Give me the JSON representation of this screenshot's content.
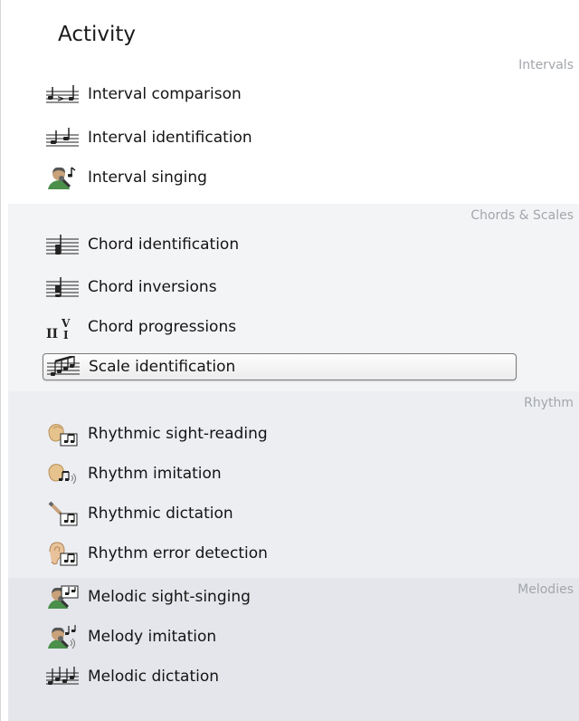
{
  "panel": {
    "title": "Activity"
  },
  "sections": [
    {
      "header": "Intervals",
      "items": [
        {
          "label": "Interval comparison",
          "icon": "interval-comparison-icon"
        },
        {
          "label": "Interval identification",
          "icon": "interval-identification-icon"
        },
        {
          "label": "Interval singing",
          "icon": "singer-microphone-icon"
        }
      ]
    },
    {
      "header": "Chords & Scales",
      "items": [
        {
          "label": "Chord identification",
          "icon": "chord-icon"
        },
        {
          "label": "Chord inversions",
          "icon": "chord-inversion-icon"
        },
        {
          "label": "Chord progressions",
          "icon": "roman-numerals-icon"
        },
        {
          "label": "Scale identification",
          "icon": "scale-notes-icon",
          "selected": true
        }
      ]
    },
    {
      "header": "Rhythm",
      "items": [
        {
          "label": "Rhythmic sight-reading",
          "icon": "clapping-hands-icon"
        },
        {
          "label": "Rhythm imitation",
          "icon": "clapping-hands-sound-icon"
        },
        {
          "label": "Rhythmic dictation",
          "icon": "pencil-rhythm-icon"
        },
        {
          "label": "Rhythm error detection",
          "icon": "ear-rhythm-icon"
        }
      ]
    },
    {
      "header": "Melodies",
      "items": [
        {
          "label": "Melodic sight-singing",
          "icon": "singer-melody-icon"
        },
        {
          "label": "Melody imitation",
          "icon": "singer-imitation-icon"
        },
        {
          "label": "Melodic dictation",
          "icon": "melody-notes-icon"
        }
      ]
    }
  ]
}
